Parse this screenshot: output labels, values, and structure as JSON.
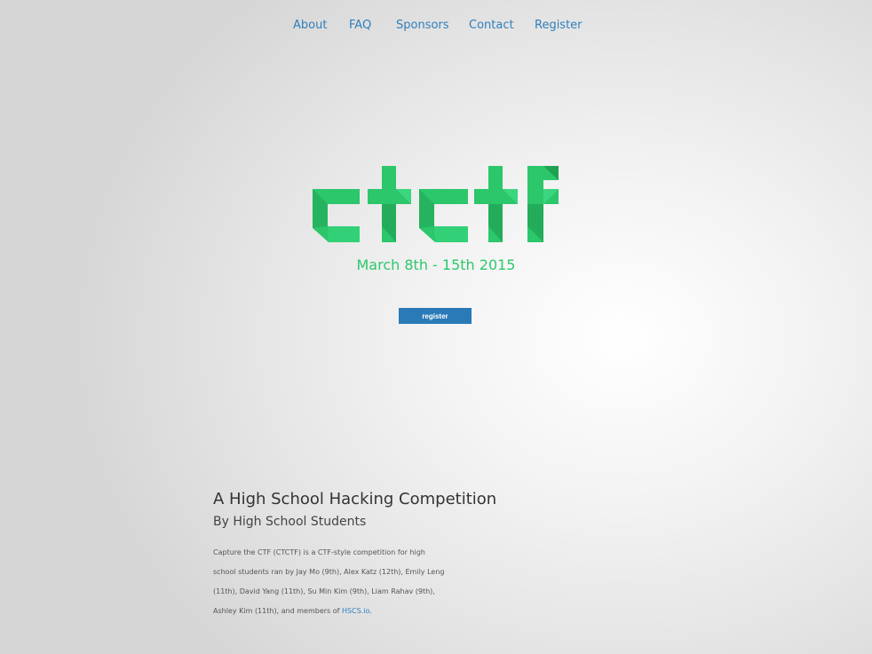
{
  "nav": {
    "items": [
      {
        "label": "About"
      },
      {
        "label": "FAQ"
      },
      {
        "label": "Sponsors"
      },
      {
        "label": "Contact"
      },
      {
        "label": "Register"
      }
    ]
  },
  "hero": {
    "logo_text": "ctctf",
    "dates": "March 8th - 15th 2015",
    "register_button": "register",
    "logo_color": "#2ec86c",
    "button_color": "#2a7ab8"
  },
  "about": {
    "heading": "A High School Hacking Competition",
    "subheading": "By High School Students",
    "lines": [
      "Capture the CTF (CTCTF) is a CTF-style competition for high",
      "school students ran by Jay Mo (9th), Alex Katz (12th), Emily Leng",
      "(11th), David Yang (11th), Su Min Kim (9th), Liam Rahav (9th),",
      "Ashley Kim (11th), and members of "
    ],
    "link_text": "HSCS.io",
    "link_suffix": "."
  },
  "colors": {
    "link": "#2f7fbc",
    "accent_green": "#2ec86c"
  }
}
